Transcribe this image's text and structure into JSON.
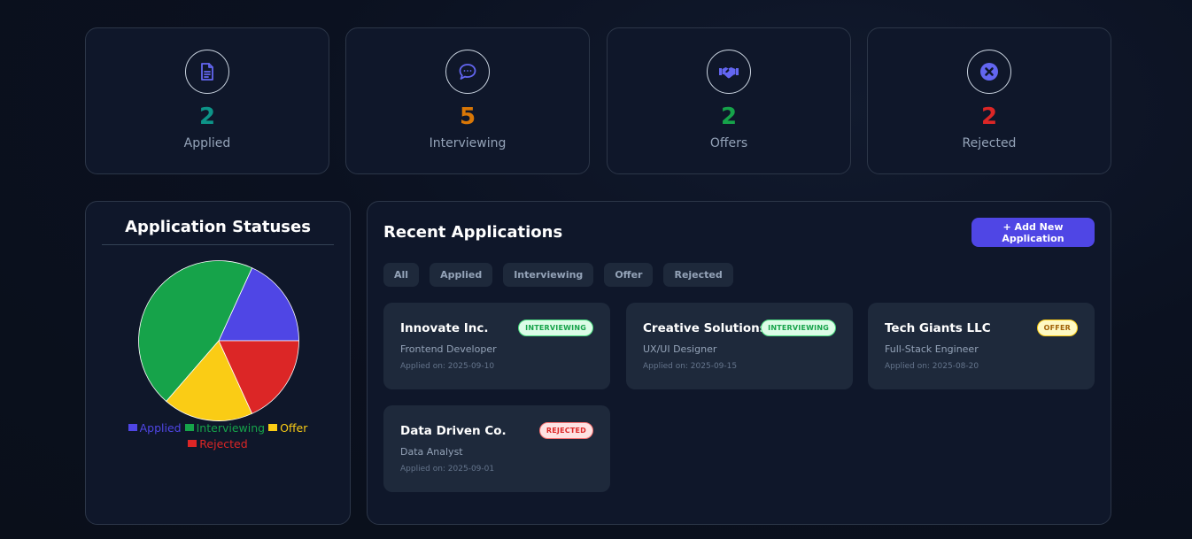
{
  "stats": [
    {
      "value": "2",
      "label": "Applied",
      "icon": "document-icon",
      "color": "#0d9488"
    },
    {
      "value": "5",
      "label": "Interviewing",
      "icon": "chat-bubble-icon",
      "color": "#d97706"
    },
    {
      "value": "2",
      "label": "Offers",
      "icon": "handshake-icon",
      "color": "#16a34a"
    },
    {
      "value": "2",
      "label": "Rejected",
      "icon": "x-circle-icon",
      "color": "#dc2626"
    }
  ],
  "accent_color": "#4f46e5",
  "status_chart": {
    "title": "Application Statuses"
  },
  "chart_data": {
    "type": "pie",
    "categories": [
      "Applied",
      "Interviewing",
      "Offer",
      "Rejected"
    ],
    "values": [
      2,
      5,
      2,
      2
    ],
    "colors": [
      "#4f46e5",
      "#16a34a",
      "#facc15",
      "#dc2626"
    ],
    "legend_position": "bottom"
  },
  "recent": {
    "title": "Recent Applications",
    "add_button_label": "+ Add New Application",
    "filters": [
      "All",
      "Applied",
      "Interviewing",
      "Offer",
      "Rejected"
    ],
    "applications": [
      {
        "company": "Innovate Inc.",
        "role": "Frontend Developer",
        "date": "Applied on: 2025-09-10",
        "status": "INTERVIEWING",
        "status_key": "interviewing"
      },
      {
        "company": "Creative Solutions",
        "role": "UX/UI Designer",
        "date": "Applied on: 2025-09-15",
        "status": "INTERVIEWING",
        "status_key": "interviewing"
      },
      {
        "company": "Tech Giants LLC",
        "role": "Full-Stack Engineer",
        "date": "Applied on: 2025-08-20",
        "status": "OFFER",
        "status_key": "offer"
      },
      {
        "company": "Data Driven Co.",
        "role": "Data Analyst",
        "date": "Applied on: 2025-09-01",
        "status": "REJECTED",
        "status_key": "rejected"
      }
    ]
  }
}
